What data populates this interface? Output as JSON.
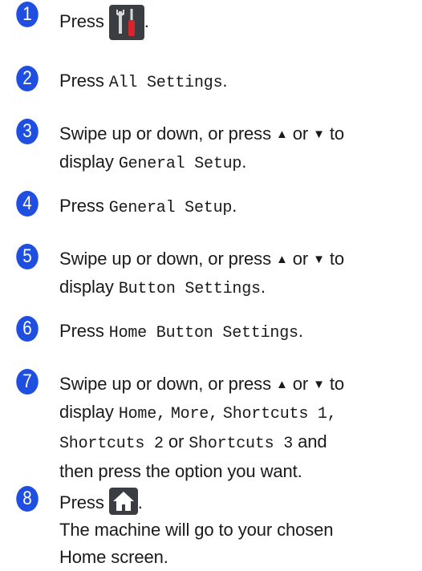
{
  "colors": {
    "step_circle": "#1f4fe0",
    "text": "#1a1a1a",
    "icon_bg": "#3a3d42",
    "screwdriver_handle": "#d9232d"
  },
  "steps": [
    {
      "number": "1",
      "prefix": "Press",
      "icon": "tools-icon",
      "suffix": "."
    },
    {
      "number": "2",
      "prefix": "Press",
      "code": "All Settings",
      "suffix": "."
    },
    {
      "number": "3",
      "line1": "Swipe up or down, or press",
      "up": "▲",
      "or": "or",
      "down": "▼",
      "to": "to",
      "line2_prefix": "display",
      "code": "General Setup",
      "suffix": "."
    },
    {
      "number": "4",
      "prefix": "Press",
      "code": "General Setup",
      "suffix": "."
    },
    {
      "number": "5",
      "line1": "Swipe up or down, or press",
      "up": "▲",
      "or": "or",
      "down": "▼",
      "to": "to",
      "line2_prefix": "display",
      "code": "Button Settings",
      "suffix": "."
    },
    {
      "number": "6",
      "prefix": "Press",
      "code": "Home Button Settings",
      "suffix": "."
    },
    {
      "number": "7",
      "line1": "Swipe up or down, or press",
      "up": "▲",
      "or": "or",
      "down": "▼",
      "to": "to",
      "line2_prefix": "display",
      "opt_home": "Home",
      "sep1": ",",
      "opt_more": "More",
      "sep2": ",",
      "opt_shortcuts1": "Shortcuts 1",
      "sep3": ",",
      "opt_shortcuts2": "Shortcuts 2",
      "or2": "or",
      "opt_shortcuts3": "Shortcuts 3",
      "and": "and",
      "line4": "then press the option you want."
    },
    {
      "number": "8",
      "prefix": "Press",
      "icon": "home-icon",
      "suffix": ".",
      "result": "The machine will go to your chosen Home screen."
    }
  ]
}
